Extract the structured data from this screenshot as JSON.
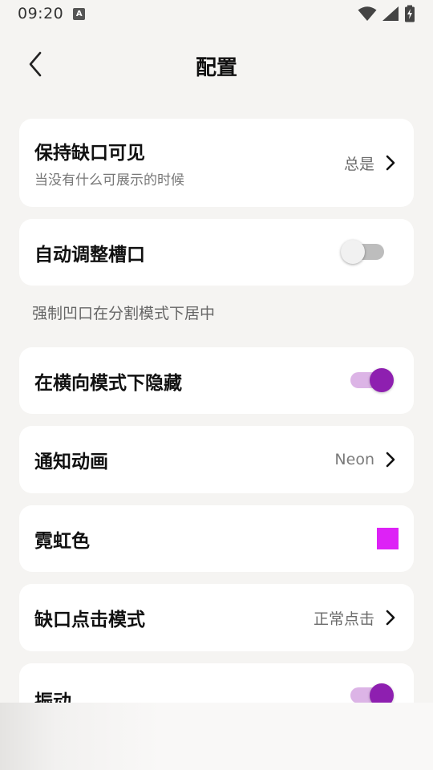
{
  "status_bar": {
    "time": "09:20",
    "a_badge": "A",
    "icons": [
      "wifi-icon",
      "signal-icon",
      "battery-charging-icon"
    ]
  },
  "app_bar": {
    "back_icon": "chevron-left-icon",
    "title": "配置"
  },
  "settings": {
    "keep_notch_visible": {
      "title": "保持缺口可见",
      "subtitle": "当没有什么可展示的时候",
      "value": "总是"
    },
    "auto_adjust_slot": {
      "title": "自动调整槽口",
      "enabled": false
    },
    "section_note": "强制凹口在分割模式下居中",
    "hide_in_landscape": {
      "title": "在横向模式下隐藏",
      "enabled": true
    },
    "notification_animation": {
      "title": "通知动画",
      "value": "Neon"
    },
    "neon_color": {
      "title": "霓虹色",
      "color": "#dd22f6"
    },
    "notch_click_mode": {
      "title": "缺口点击模式",
      "value": "正常点击"
    },
    "vibration": {
      "title": "振动",
      "enabled": true
    }
  },
  "colors": {
    "background": "#f5f4f2",
    "card": "#ffffff",
    "accent": "#8e1fb0",
    "accent_track": "#dcb4e6"
  }
}
